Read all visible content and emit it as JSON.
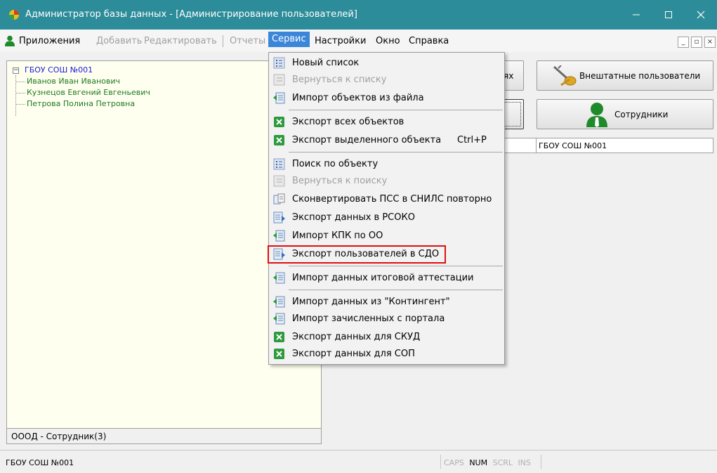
{
  "window": {
    "title": "Администратор базы данных - [Администрирование пользователей]"
  },
  "menubar": {
    "items": [
      "Приложения",
      "Добавить",
      "Редактировать",
      "Отчеты",
      "Сервис",
      "Настройки",
      "Окно",
      "Справка"
    ]
  },
  "tree": {
    "root": "ГБОУ СОШ №001",
    "children": [
      "Иванов Иван Иванович",
      "Кузнецов Евгений Евгеньевич",
      "Петрова Полина Петровна"
    ],
    "status": "ОООД - Сотрудник(3)"
  },
  "right": {
    "button1_label": "ях",
    "button2_label": "Внештатные пользователи",
    "button4_label": "Сотрудники",
    "org_field_value": "ГБОУ СОШ №001"
  },
  "statusbar": {
    "org": "ГБОУ СОШ №001",
    "caps": "CAPS",
    "num": "NUM",
    "scrl": "SCRL",
    "ins": "INS"
  },
  "dropdown": {
    "items": [
      {
        "label": "Новый список",
        "icon": "list-icon"
      },
      {
        "label": "Вернуться к списку",
        "icon": "return-list-icon"
      },
      {
        "label": "Импорт объектов из файла",
        "icon": "import-icon"
      },
      {
        "label": "Экспорт всех объектов",
        "icon": "excel-icon"
      },
      {
        "label": "Экспорт выделенного объекта",
        "icon": "excel-icon",
        "shortcut": "Ctrl+P"
      },
      {
        "label": "Поиск по объекту",
        "icon": "search-list-icon"
      },
      {
        "label": "Вернуться к поиску",
        "icon": "return-search-icon"
      },
      {
        "label": "Сконвертировать ПСС в СНИЛС повторно",
        "icon": "convert-icon"
      },
      {
        "label": "Экспорт данных в РСОКО",
        "icon": "export-icon"
      },
      {
        "label": "Импорт КПК по ОО",
        "icon": "import-icon"
      },
      {
        "label": "Экспорт пользователей в СДО",
        "icon": "export-icon"
      },
      {
        "label": "Импорт данных итоговой аттестации",
        "icon": "import-icon"
      },
      {
        "label": "Импорт данных из \"Контингент\"",
        "icon": "import-icon"
      },
      {
        "label": "Импорт зачисленных с портала",
        "icon": "import-icon"
      },
      {
        "label": "Экспорт данных для СКУД",
        "icon": "excel-icon"
      },
      {
        "label": "Экспорт данных для СОП",
        "icon": "excel-icon"
      }
    ]
  },
  "colors": {
    "titlebar": "#2d8c9a",
    "menu_active": "#3b86d8",
    "highlight_outline": "#e01010",
    "tree_root": "#1a1ad8",
    "tree_child": "#1e7a1e"
  }
}
